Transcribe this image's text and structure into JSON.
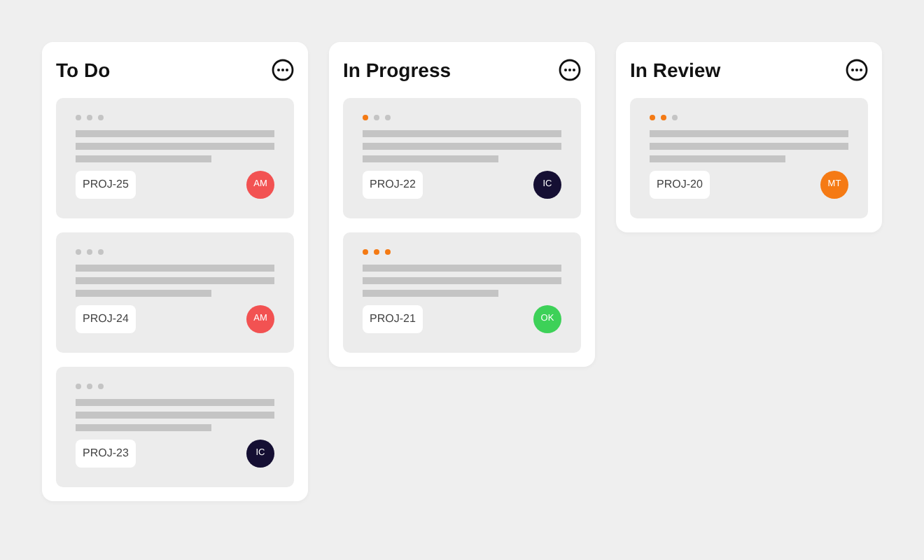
{
  "columns": [
    {
      "title": "To Do",
      "cards": [
        {
          "dots": [
            {
              "filled": false
            },
            {
              "filled": false
            },
            {
              "filled": false
            }
          ],
          "id": "PROJ-25",
          "assignee": {
            "initials": "AM",
            "color": "#f25252"
          }
        },
        {
          "dots": [
            {
              "filled": false
            },
            {
              "filled": false
            },
            {
              "filled": false
            }
          ],
          "id": "PROJ-24",
          "assignee": {
            "initials": "AM",
            "color": "#f25252"
          }
        },
        {
          "dots": [
            {
              "filled": false
            },
            {
              "filled": false
            },
            {
              "filled": false
            }
          ],
          "id": "PROJ-23",
          "assignee": {
            "initials": "IC",
            "color": "#150f33"
          }
        }
      ]
    },
    {
      "title": "In Progress",
      "cards": [
        {
          "dots": [
            {
              "filled": true
            },
            {
              "filled": false
            },
            {
              "filled": false
            }
          ],
          "id": "PROJ-22",
          "assignee": {
            "initials": "IC",
            "color": "#150f33"
          }
        },
        {
          "dots": [
            {
              "filled": true
            },
            {
              "filled": true
            },
            {
              "filled": true
            }
          ],
          "id": "PROJ-21",
          "assignee": {
            "initials": "OK",
            "color": "#3dd158"
          }
        }
      ]
    },
    {
      "title": "In Review",
      "cards": [
        {
          "dots": [
            {
              "filled": true
            },
            {
              "filled": true
            },
            {
              "filled": false
            }
          ],
          "id": "PROJ-20",
          "assignee": {
            "initials": "MT",
            "color": "#f57a14"
          }
        }
      ]
    }
  ]
}
